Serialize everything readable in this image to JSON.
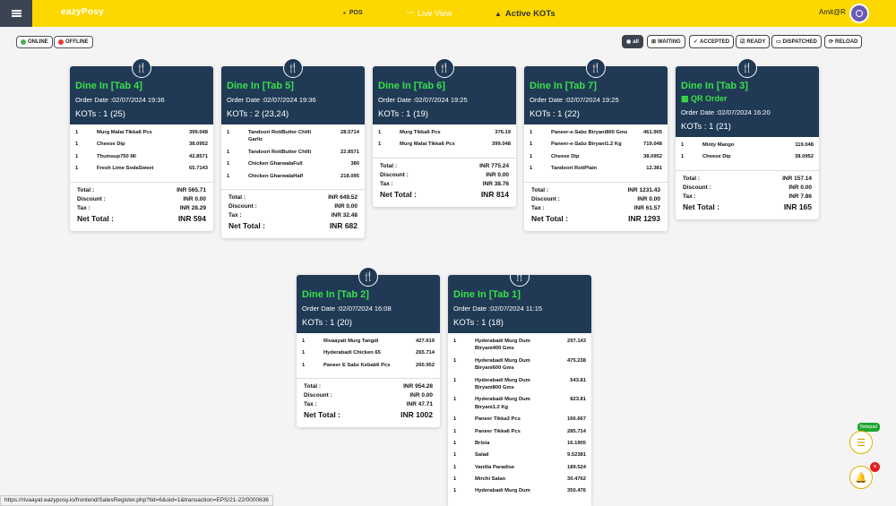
{
  "app": {
    "logo": "eazyPosy",
    "nav": {
      "pos": "POS",
      "live": "Live View",
      "kots": "Active KOTs"
    },
    "user": "Amit@R"
  },
  "filters": {
    "online": "ONLINE",
    "offline": "OFFLINE",
    "all": "all",
    "waiting": "WAITING",
    "accepted": "ACCEPTED",
    "ready": "READY",
    "dispatched": "DISPATCHED",
    "reload": "RELOAD"
  },
  "labels": {
    "total": "Total :",
    "discount": "Discount :",
    "tax": "Tax :",
    "net_total": "Net Total :"
  },
  "cards": [
    {
      "title": "Dine In [Tab 4]",
      "date": "Order Date :02/07/2024 19:36",
      "kots": "KOTs : 1 (25)",
      "items": [
        [
          "1",
          "Murg Malai Tikka6 Pcs",
          "399.048"
        ],
        [
          "1",
          "Cheese Dip",
          "38.0952"
        ],
        [
          "1",
          "Thumsup750 Ml",
          "42.8571"
        ],
        [
          "1",
          "Fresh Lime SodaSweet",
          "65.7143"
        ]
      ],
      "total": "INR 565.71",
      "discount": "INR 0.00",
      "tax": "INR 28.29",
      "net": "INR 594"
    },
    {
      "title": "Dine In [Tab 5]",
      "date": "Order Date :02/07/2024 19:36",
      "kots": "KOTs : 2 (23,24)",
      "items": [
        [
          "1",
          "Tandoori RotiButter Chilli Garlic",
          "28.5714"
        ],
        [
          "1",
          "Tandoori RotiButter Chilli",
          "22.8571"
        ],
        [
          "1",
          "Chicken GharwalaFull",
          "380"
        ],
        [
          "1",
          "Chicken GharwalaHalf",
          "218.095"
        ]
      ],
      "total": "INR 649.52",
      "discount": "INR 0.00",
      "tax": "INR 32.48",
      "net": "INR 682"
    },
    {
      "title": "Dine In [Tab 6]",
      "date": "Order Date :02/07/2024 19:25",
      "kots": "KOTs : 1 (19)",
      "items": [
        [
          "1",
          "Murg Tikka6 Pcs",
          "376.19"
        ],
        [
          "1",
          "Murg Malai Tikka6 Pcs",
          "399.048"
        ]
      ],
      "total": "INR 775.24",
      "discount": "INR 0.00",
      "tax": "INR 38.76",
      "net": "INR 814"
    },
    {
      "title": "Dine In [Tab 7]",
      "date": "Order Date :02/07/2024 19:25",
      "kots": "KOTs : 1 (22)",
      "items": [
        [
          "1",
          "Paneer-e-Sabz Biryani800 Gms",
          "461.905"
        ],
        [
          "1",
          "Paneer-e-Sabz Biryani1.2 Kg",
          "719.048"
        ],
        [
          "1",
          "Cheese Dip",
          "38.0952"
        ],
        [
          "1",
          "Tandoori RotiPlain",
          "12.381"
        ]
      ],
      "total": "INR 1231.43",
      "discount": "INR 0.00",
      "tax": "INR 61.57",
      "net": "INR 1293"
    },
    {
      "title": "Dine In [Tab 3]",
      "qr": "QR Order",
      "date": "Order Date :02/07/2024 16:20",
      "kots": "KOTs : 1 (21)",
      "items": [
        [
          "1",
          "Minty Mango",
          "119.048"
        ],
        [
          "1",
          "Cheese Dip",
          "38.0952"
        ]
      ],
      "total": "INR 157.14",
      "discount": "INR 0.00",
      "tax": "INR 7.86",
      "net": "INR 165"
    },
    {
      "title": "Dine In [Tab 2]",
      "date": "Order Date :02/07/2024 16:08",
      "kots": "KOTs : 1 (20)",
      "items": [
        [
          "1",
          "Rivaayati Murg Tangdi",
          "427.619"
        ],
        [
          "1",
          "Hyderabadi Chicken 65",
          "265.714"
        ],
        [
          "1",
          "Paneer E Sabz Kebab6 Pcs",
          "260.952"
        ]
      ],
      "total": "INR 954.28",
      "discount": "INR 0.00",
      "tax": "INR 47.71",
      "net": "INR 1002"
    },
    {
      "title": "Dine In [Tab 1]",
      "date": "Order Date :02/07/2024 11:15",
      "kots": "KOTs : 1 (18)",
      "items": [
        [
          "1",
          "Hyderabadi Murg Dum Biryani400 Gms",
          "297.143"
        ],
        [
          "1",
          "Hyderabadi Murg Dum Biryani600 Gms",
          "475.238"
        ],
        [
          "1",
          "Hyderabadi Murg Dum Biryani800 Gms",
          "543.81"
        ],
        [
          "1",
          "Hyderabadi Murg Dum Biryani1.2 Kg",
          "823.81"
        ],
        [
          "1",
          "Paneer Tikka3 Pcs",
          "166.667"
        ],
        [
          "1",
          "Paneer Tikka6 Pcs",
          "285.714"
        ],
        [
          "1",
          "Brista",
          "16.1905"
        ],
        [
          "1",
          "Salad",
          "9.52381"
        ],
        [
          "1",
          "Vanilla Paradise",
          "189.524"
        ],
        [
          "1",
          "Mirchi Salan",
          "30.4762"
        ],
        [
          "1",
          "Hyderabadi Murg Dum",
          "350.476"
        ]
      ]
    }
  ],
  "floating": {
    "notepad": "Notepad"
  },
  "statusbar": "https://rivaayat.eazyposy.io/frontend/SalesRegister.php?tid=6&oid=1&transaction=EPS/21-22/0000636"
}
